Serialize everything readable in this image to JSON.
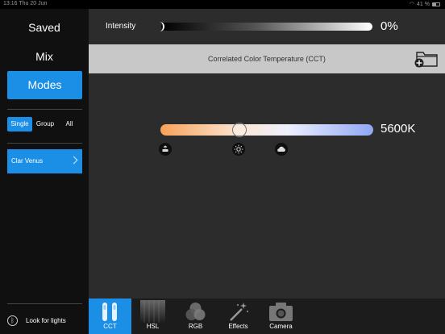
{
  "status_bar": {
    "time": "13:16  Thu 20 Jun",
    "battery": "41 %"
  },
  "sidebar": {
    "saved": "Saved",
    "mix": "Mix",
    "modes": "Modes",
    "segments": [
      "Single",
      "Group",
      "All"
    ],
    "active_segment": "Single",
    "device": "Clar Venus",
    "look_for_lights": "Look for lights"
  },
  "intensity": {
    "label": "Intensity",
    "value_text": "0%",
    "value": 0
  },
  "cct_header": {
    "title": "Correlated Color Temperature (CCT)"
  },
  "cct": {
    "value_text": "5600K",
    "position": 0.37
  },
  "presets": [
    "tungsten-icon",
    "sun-icon",
    "cloud-icon"
  ],
  "tabs": [
    {
      "label": "CCT",
      "active": true
    },
    {
      "label": "HSL",
      "active": false
    },
    {
      "label": "RGB",
      "active": false
    },
    {
      "label": "Effects",
      "active": false
    },
    {
      "label": "Camera",
      "active": false
    }
  ],
  "colors": {
    "accent": "#1b8ee6",
    "panel": "#2c2c2c",
    "sidebar": "#101010"
  }
}
